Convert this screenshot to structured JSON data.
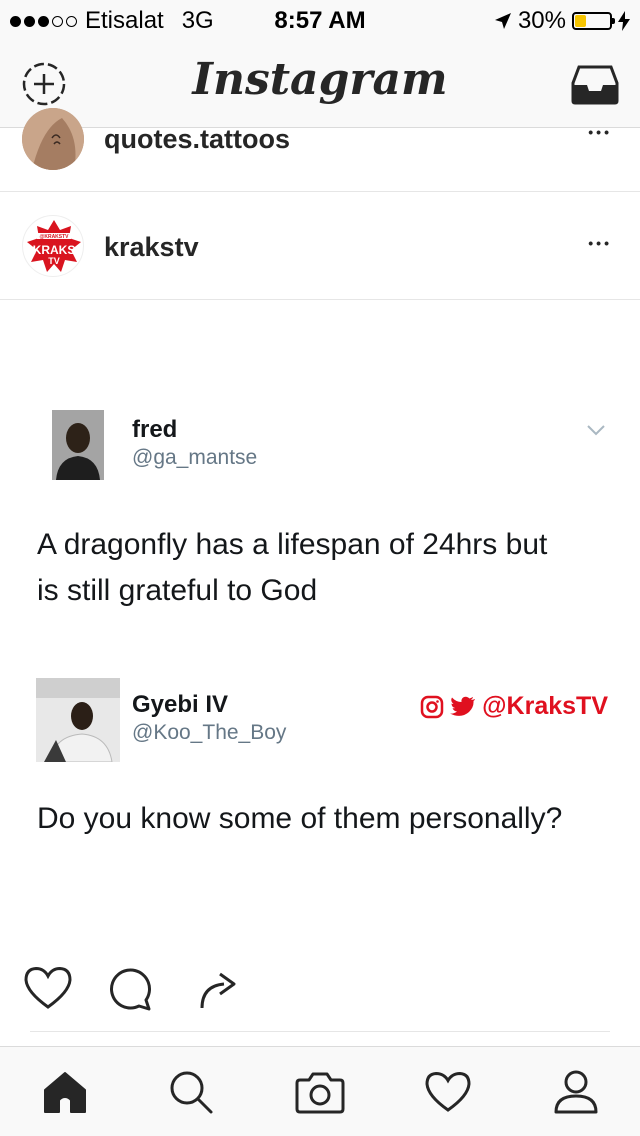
{
  "status_bar": {
    "carrier": "Etisalat",
    "network": "3G",
    "time": "8:57 AM",
    "battery_percent": "30%",
    "signal_bars_filled": 3,
    "signal_bars_total": 5,
    "battery_level": 0.3,
    "battery_color": "#f5c400"
  },
  "app_bar": {
    "title": "Instagram",
    "left_icon": "new-story-plus-icon",
    "right_icon": "direct-inbox-icon"
  },
  "posts": [
    {
      "username": "quotes.tattoos",
      "more": "•••"
    },
    {
      "username": "krakstv",
      "more": "•••",
      "avatar_text": [
        "@KRAKSTV",
        "KRAKS",
        "TV"
      ]
    }
  ],
  "tweet_image": {
    "tweet": {
      "name": "fred",
      "handle": "@ga_mantse",
      "text_line1": "A dragonfly has a lifespan of 24hrs but",
      "text_line2": "is still grateful to God"
    },
    "reply": {
      "name": "Gyebi IV",
      "handle": "@Koo_The_Boy",
      "text": "Do you know some of them personally?"
    },
    "watermark": "@KraksTV",
    "watermark_color": "#e0101f"
  },
  "actions": [
    "heart-icon",
    "comment-icon",
    "share-icon"
  ],
  "tab_bar": [
    "home-icon",
    "search-icon",
    "camera-icon",
    "activity-heart-icon",
    "profile-icon"
  ]
}
